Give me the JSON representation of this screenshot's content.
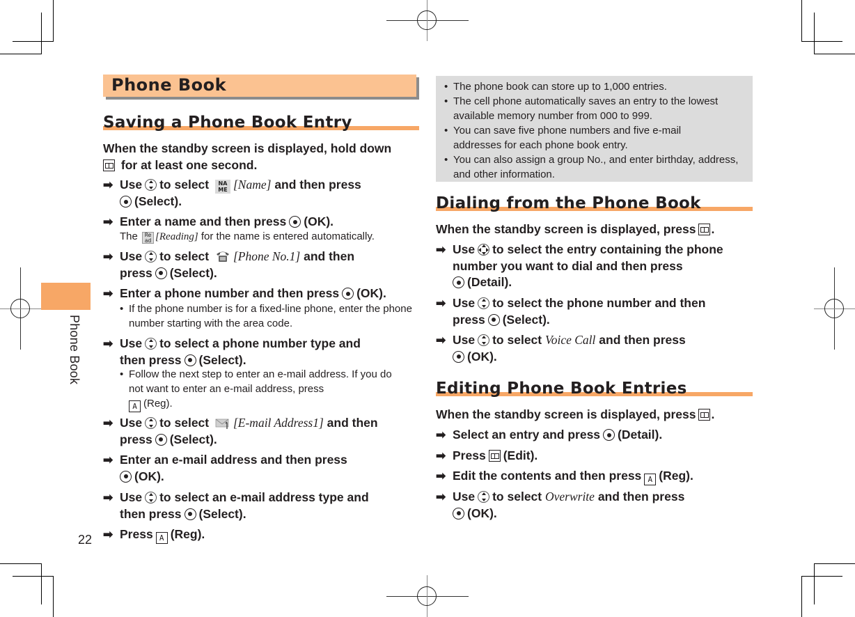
{
  "page": {
    "chapter_tab": "Phone Book",
    "page_number": "22",
    "tab_color": "#f7a766",
    "title_bar_color": "#fbc291",
    "note_box_color": "#dcdcdc"
  },
  "title": "Phone Book",
  "left": {
    "heading": "Saving a Phone Book Entry",
    "intro_a": "When the standby screen is displayed, hold down",
    "intro_b": "for at least one second.",
    "steps": [
      {
        "a": "Use",
        "b": "to select",
        "item": "[Name]",
        "c": "and then press",
        "d": "(Select)."
      },
      {
        "a": "Enter a name and then press",
        "d": "(OK).",
        "note_a": "The",
        "note_item": "[Reading]",
        "note_b": "for the name is entered automatically."
      },
      {
        "a": "Use",
        "b": "to select",
        "item": "[Phone No.1]",
        "c": "and then",
        "c2": "press",
        "d": "(Select)."
      },
      {
        "a": "Enter a phone number and then press",
        "d": "(OK).",
        "note": "If the phone number is for a fixed-line phone, enter the phone number starting with the area code."
      },
      {
        "a": "Use",
        "b": "to select a phone number type and",
        "c2": "then press",
        "d": "(Select).",
        "note_a": "Follow the next step to enter an e-mail address. If you do not want to enter an e-mail address, press",
        "note_b": "(Reg)."
      },
      {
        "a": "Use",
        "b": "to select",
        "item": "[E-mail Address1]",
        "c": "and then",
        "c2": "press",
        "d": "(Select)."
      },
      {
        "a": "Enter an e-mail address and then press",
        "d": "(OK)."
      },
      {
        "a": "Use",
        "b": "to select an e-mail address type and",
        "c2": "then press",
        "d": "(Select)."
      },
      {
        "a": "Press",
        "d": "(Reg)."
      }
    ]
  },
  "notes": [
    "The phone book can store up to 1,000 entries.",
    "The cell phone automatically saves an entry to the lowest available memory number from 000 to 999.",
    "You can save five phone numbers and five e-mail addresses for each phone book entry.",
    "You can also assign a group No., and enter birthday, address, and other information."
  ],
  "dialing": {
    "heading": "Dialing from the Phone Book",
    "intro": "When the standby screen is displayed, press",
    "steps": [
      {
        "a": "Use",
        "b": "to select the entry containing the phone number you want to dial and then press",
        "d": "(Detail)."
      },
      {
        "a": "Use",
        "b": "to select the phone number and then",
        "c2": "press",
        "d": "(Select)."
      },
      {
        "a": "Use",
        "b": "to select",
        "item": "Voice Call",
        "c": "and then press",
        "d": "(OK)."
      }
    ]
  },
  "editing": {
    "heading": "Editing Phone Book Entries",
    "intro": "When the standby screen is displayed, press",
    "steps": [
      {
        "a": "Select an entry and press",
        "d": "(Detail)."
      },
      {
        "a": "Press",
        "d": "(Edit)."
      },
      {
        "a": "Edit the contents and then press",
        "d": "(Reg)."
      },
      {
        "a": "Use",
        "b": "to select",
        "item": "Overwrite",
        "c": "and then press",
        "d": "(OK)."
      }
    ]
  },
  "glyphs": {
    "arrow": "➡",
    "bullet": "•",
    "a_key": "A",
    "name_icon_top": "NA",
    "name_icon_bottom": "ME",
    "read_icon_top": "Re",
    "read_icon_bottom": "ad"
  }
}
